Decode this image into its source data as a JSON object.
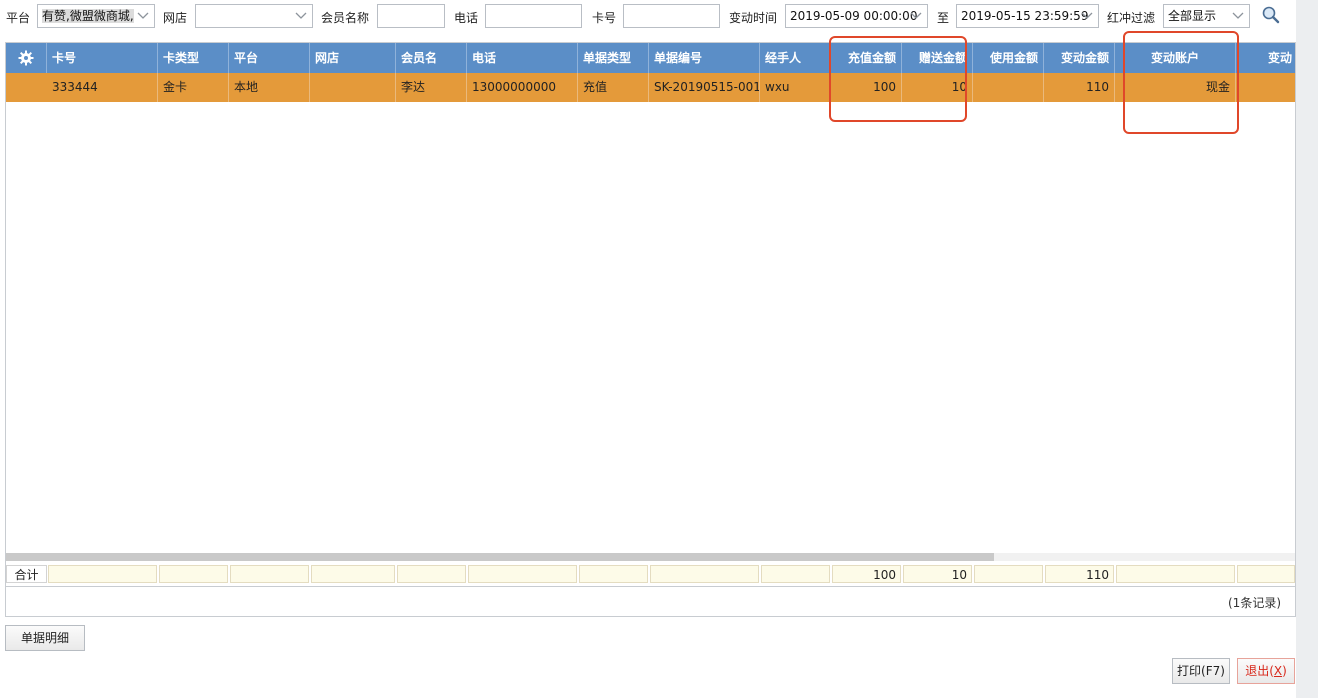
{
  "filters": {
    "platform_label": "平台",
    "platform_value": "有赞,微盟微商城,",
    "shop_label": "网店",
    "shop_value": "",
    "member_name_label": "会员名称",
    "member_name_value": "",
    "phone_label": "电话",
    "phone_value": "",
    "card_no_label": "卡号",
    "card_no_value": "",
    "change_time_label": "变动时间",
    "time_from": "2019-05-09 00:00:00",
    "to_label": "至",
    "time_to": "2019-05-15 23:59:59",
    "reverse_filter_label": "红冲过滤",
    "reverse_filter_value": "全部显示",
    "search_icon": "magnifier-icon"
  },
  "grid": {
    "settings_icon": "gear-icon",
    "columns": [
      "卡号",
      "卡类型",
      "平台",
      "网店",
      "会员名",
      "电话",
      "单据类型",
      "单据编号",
      "经手人",
      "充值金额",
      "赠送金额",
      "使用金额",
      "变动金额",
      "变动账户",
      "变动"
    ],
    "rows": [
      {
        "card_no": "333444",
        "card_type": "金卡",
        "platform": "本地",
        "shop": "",
        "member_name": "李达",
        "phone": "13000000000",
        "doc_type": "充值",
        "doc_no": "SK-20190515-001",
        "handler": "wxu",
        "recharge": "100",
        "bonus": "10",
        "used": "",
        "change": "110",
        "account": "现金",
        "extra": ""
      }
    ],
    "totals": {
      "label": "合计",
      "recharge": "100",
      "bonus": "10",
      "change": "110"
    },
    "record_count": "(1条记录)"
  },
  "buttons": {
    "detail": "单据明细",
    "print": "打印(F7)",
    "exit_prefix": "退出(",
    "exit_key": "X",
    "exit_suffix": ")"
  },
  "colors": {
    "header": "#5b8ec7",
    "selected_row": "#e49a3a",
    "highlight": "#e0472a",
    "totals_bg": "#fdfbe8"
  }
}
